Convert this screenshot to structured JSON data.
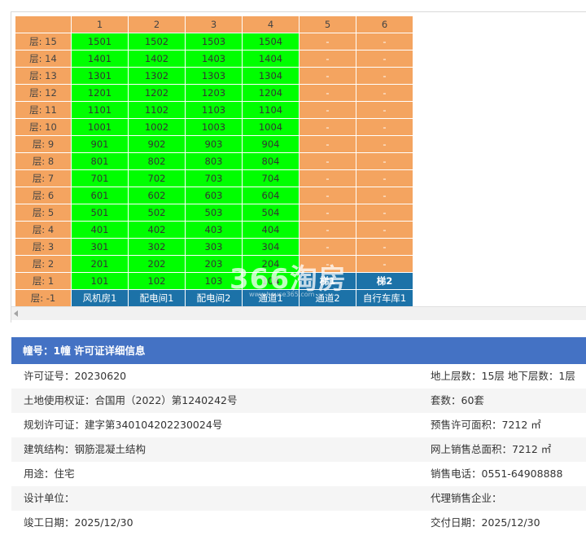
{
  "grid": {
    "col_headers": [
      "1",
      "2",
      "3",
      "4",
      "5",
      "6"
    ],
    "rows": [
      {
        "floor": "层: 15",
        "cells": [
          [
            "1501",
            "green"
          ],
          [
            "1502",
            "green"
          ],
          [
            "1503",
            "green"
          ],
          [
            "1504",
            "green"
          ],
          [
            "-",
            "orange"
          ],
          [
            "-",
            "orange"
          ]
        ]
      },
      {
        "floor": "层: 14",
        "cells": [
          [
            "1401",
            "green"
          ],
          [
            "1402",
            "green"
          ],
          [
            "1403",
            "green"
          ],
          [
            "1404",
            "green"
          ],
          [
            "-",
            "orange"
          ],
          [
            "-",
            "orange"
          ]
        ]
      },
      {
        "floor": "层: 13",
        "cells": [
          [
            "1301",
            "green"
          ],
          [
            "1302",
            "green"
          ],
          [
            "1303",
            "green"
          ],
          [
            "1304",
            "green"
          ],
          [
            "-",
            "orange"
          ],
          [
            "-",
            "orange"
          ]
        ]
      },
      {
        "floor": "层: 12",
        "cells": [
          [
            "1201",
            "green"
          ],
          [
            "1202",
            "green"
          ],
          [
            "1203",
            "green"
          ],
          [
            "1204",
            "green"
          ],
          [
            "-",
            "orange"
          ],
          [
            "-",
            "orange"
          ]
        ]
      },
      {
        "floor": "层: 11",
        "cells": [
          [
            "1101",
            "green"
          ],
          [
            "1102",
            "green"
          ],
          [
            "1103",
            "green"
          ],
          [
            "1104",
            "green"
          ],
          [
            "-",
            "orange"
          ],
          [
            "-",
            "orange"
          ]
        ]
      },
      {
        "floor": "层: 10",
        "cells": [
          [
            "1001",
            "green"
          ],
          [
            "1002",
            "green"
          ],
          [
            "1003",
            "green"
          ],
          [
            "1004",
            "green"
          ],
          [
            "-",
            "orange"
          ],
          [
            "-",
            "orange"
          ]
        ]
      },
      {
        "floor": "层: 9",
        "cells": [
          [
            "901",
            "green"
          ],
          [
            "902",
            "green"
          ],
          [
            "903",
            "green"
          ],
          [
            "904",
            "green"
          ],
          [
            "-",
            "orange"
          ],
          [
            "-",
            "orange"
          ]
        ]
      },
      {
        "floor": "层: 8",
        "cells": [
          [
            "801",
            "green"
          ],
          [
            "802",
            "green"
          ],
          [
            "803",
            "green"
          ],
          [
            "804",
            "green"
          ],
          [
            "-",
            "orange"
          ],
          [
            "-",
            "orange"
          ]
        ]
      },
      {
        "floor": "层: 7",
        "cells": [
          [
            "701",
            "green"
          ],
          [
            "702",
            "green"
          ],
          [
            "703",
            "green"
          ],
          [
            "704",
            "green"
          ],
          [
            "-",
            "orange"
          ],
          [
            "-",
            "orange"
          ]
        ]
      },
      {
        "floor": "层: 6",
        "cells": [
          [
            "601",
            "green"
          ],
          [
            "602",
            "green"
          ],
          [
            "603",
            "green"
          ],
          [
            "604",
            "green"
          ],
          [
            "-",
            "orange"
          ],
          [
            "-",
            "orange"
          ]
        ]
      },
      {
        "floor": "层: 5",
        "cells": [
          [
            "501",
            "green"
          ],
          [
            "502",
            "green"
          ],
          [
            "503",
            "green"
          ],
          [
            "504",
            "green"
          ],
          [
            "-",
            "orange"
          ],
          [
            "-",
            "orange"
          ]
        ]
      },
      {
        "floor": "层: 4",
        "cells": [
          [
            "401",
            "green"
          ],
          [
            "402",
            "green"
          ],
          [
            "403",
            "green"
          ],
          [
            "404",
            "green"
          ],
          [
            "-",
            "orange"
          ],
          [
            "-",
            "orange"
          ]
        ]
      },
      {
        "floor": "层: 3",
        "cells": [
          [
            "301",
            "green"
          ],
          [
            "302",
            "green"
          ],
          [
            "303",
            "green"
          ],
          [
            "304",
            "green"
          ],
          [
            "-",
            "orange"
          ],
          [
            "-",
            "orange"
          ]
        ]
      },
      {
        "floor": "层: 2",
        "cells": [
          [
            "201",
            "green"
          ],
          [
            "202",
            "green"
          ],
          [
            "203",
            "green"
          ],
          [
            "204",
            "green"
          ],
          [
            "-",
            "orange"
          ],
          [
            "-",
            "orange"
          ]
        ]
      },
      {
        "floor": "层: 1",
        "cells": [
          [
            "101",
            "green"
          ],
          [
            "102",
            "green"
          ],
          [
            "103",
            "green"
          ],
          [
            "104",
            "green"
          ],
          [
            "梯1",
            "blue"
          ],
          [
            "梯2",
            "blue"
          ]
        ]
      },
      {
        "floor": "层: -1",
        "cells": [
          [
            "风机房1",
            "blue-plain"
          ],
          [
            "配电间1",
            "blue-plain"
          ],
          [
            "配电间2",
            "blue-plain"
          ],
          [
            "通道1",
            "blue-plain"
          ],
          [
            "通道2",
            "blue-plain"
          ],
          [
            "自行车库1",
            "blue-plain"
          ]
        ]
      }
    ]
  },
  "watermark": {
    "text": "366淘房",
    "sub": "www.house365.com"
  },
  "colors": {
    "available": "#00ff00",
    "empty": "#f4a460",
    "facility": "#1c72a8",
    "header_bar": "#4472c4"
  },
  "info": {
    "title": "幢号：1幢 许可证详细信息",
    "rows": [
      {
        "left": "许可证号：20230620",
        "right": "地上层数：15层  地下层数：1层"
      },
      {
        "left": "土地使用权证：合国用（2022）第1240242号",
        "right": "套数：60套"
      },
      {
        "left": "规划许可证：建字第340104202230024号",
        "right": "预售许可面积：7212 ㎡"
      },
      {
        "left": "建筑结构：钢筋混凝土结构",
        "right": "网上销售总面积：7212 ㎡"
      },
      {
        "left": "用途：住宅",
        "right": "销售电话：0551-64908888"
      },
      {
        "left": "设计单位：",
        "right": "代理销售企业："
      },
      {
        "left": "竣工日期：2025/12/30",
        "right": "交付日期：2025/12/30"
      }
    ]
  }
}
